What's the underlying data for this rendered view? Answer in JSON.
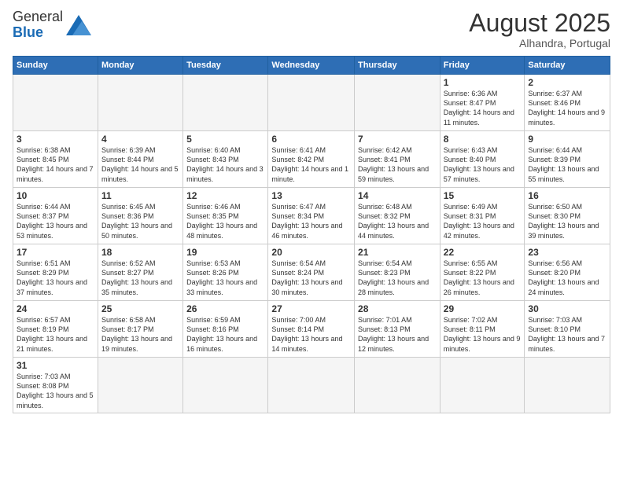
{
  "logo": {
    "general": "General",
    "blue": "Blue"
  },
  "title": {
    "month_year": "August 2025",
    "location": "Alhandra, Portugal"
  },
  "header_days": [
    "Sunday",
    "Monday",
    "Tuesday",
    "Wednesday",
    "Thursday",
    "Friday",
    "Saturday"
  ],
  "weeks": [
    [
      {
        "num": "",
        "info": ""
      },
      {
        "num": "",
        "info": ""
      },
      {
        "num": "",
        "info": ""
      },
      {
        "num": "",
        "info": ""
      },
      {
        "num": "",
        "info": ""
      },
      {
        "num": "1",
        "info": "Sunrise: 6:36 AM\nSunset: 8:47 PM\nDaylight: 14 hours and 11 minutes."
      },
      {
        "num": "2",
        "info": "Sunrise: 6:37 AM\nSunset: 8:46 PM\nDaylight: 14 hours and 9 minutes."
      }
    ],
    [
      {
        "num": "3",
        "info": "Sunrise: 6:38 AM\nSunset: 8:45 PM\nDaylight: 14 hours and 7 minutes."
      },
      {
        "num": "4",
        "info": "Sunrise: 6:39 AM\nSunset: 8:44 PM\nDaylight: 14 hours and 5 minutes."
      },
      {
        "num": "5",
        "info": "Sunrise: 6:40 AM\nSunset: 8:43 PM\nDaylight: 14 hours and 3 minutes."
      },
      {
        "num": "6",
        "info": "Sunrise: 6:41 AM\nSunset: 8:42 PM\nDaylight: 14 hours and 1 minute."
      },
      {
        "num": "7",
        "info": "Sunrise: 6:42 AM\nSunset: 8:41 PM\nDaylight: 13 hours and 59 minutes."
      },
      {
        "num": "8",
        "info": "Sunrise: 6:43 AM\nSunset: 8:40 PM\nDaylight: 13 hours and 57 minutes."
      },
      {
        "num": "9",
        "info": "Sunrise: 6:44 AM\nSunset: 8:39 PM\nDaylight: 13 hours and 55 minutes."
      }
    ],
    [
      {
        "num": "10",
        "info": "Sunrise: 6:44 AM\nSunset: 8:37 PM\nDaylight: 13 hours and 53 minutes."
      },
      {
        "num": "11",
        "info": "Sunrise: 6:45 AM\nSunset: 8:36 PM\nDaylight: 13 hours and 50 minutes."
      },
      {
        "num": "12",
        "info": "Sunrise: 6:46 AM\nSunset: 8:35 PM\nDaylight: 13 hours and 48 minutes."
      },
      {
        "num": "13",
        "info": "Sunrise: 6:47 AM\nSunset: 8:34 PM\nDaylight: 13 hours and 46 minutes."
      },
      {
        "num": "14",
        "info": "Sunrise: 6:48 AM\nSunset: 8:32 PM\nDaylight: 13 hours and 44 minutes."
      },
      {
        "num": "15",
        "info": "Sunrise: 6:49 AM\nSunset: 8:31 PM\nDaylight: 13 hours and 42 minutes."
      },
      {
        "num": "16",
        "info": "Sunrise: 6:50 AM\nSunset: 8:30 PM\nDaylight: 13 hours and 39 minutes."
      }
    ],
    [
      {
        "num": "17",
        "info": "Sunrise: 6:51 AM\nSunset: 8:29 PM\nDaylight: 13 hours and 37 minutes."
      },
      {
        "num": "18",
        "info": "Sunrise: 6:52 AM\nSunset: 8:27 PM\nDaylight: 13 hours and 35 minutes."
      },
      {
        "num": "19",
        "info": "Sunrise: 6:53 AM\nSunset: 8:26 PM\nDaylight: 13 hours and 33 minutes."
      },
      {
        "num": "20",
        "info": "Sunrise: 6:54 AM\nSunset: 8:24 PM\nDaylight: 13 hours and 30 minutes."
      },
      {
        "num": "21",
        "info": "Sunrise: 6:54 AM\nSunset: 8:23 PM\nDaylight: 13 hours and 28 minutes."
      },
      {
        "num": "22",
        "info": "Sunrise: 6:55 AM\nSunset: 8:22 PM\nDaylight: 13 hours and 26 minutes."
      },
      {
        "num": "23",
        "info": "Sunrise: 6:56 AM\nSunset: 8:20 PM\nDaylight: 13 hours and 24 minutes."
      }
    ],
    [
      {
        "num": "24",
        "info": "Sunrise: 6:57 AM\nSunset: 8:19 PM\nDaylight: 13 hours and 21 minutes."
      },
      {
        "num": "25",
        "info": "Sunrise: 6:58 AM\nSunset: 8:17 PM\nDaylight: 13 hours and 19 minutes."
      },
      {
        "num": "26",
        "info": "Sunrise: 6:59 AM\nSunset: 8:16 PM\nDaylight: 13 hours and 16 minutes."
      },
      {
        "num": "27",
        "info": "Sunrise: 7:00 AM\nSunset: 8:14 PM\nDaylight: 13 hours and 14 minutes."
      },
      {
        "num": "28",
        "info": "Sunrise: 7:01 AM\nSunset: 8:13 PM\nDaylight: 13 hours and 12 minutes."
      },
      {
        "num": "29",
        "info": "Sunrise: 7:02 AM\nSunset: 8:11 PM\nDaylight: 13 hours and 9 minutes."
      },
      {
        "num": "30",
        "info": "Sunrise: 7:03 AM\nSunset: 8:10 PM\nDaylight: 13 hours and 7 minutes."
      }
    ],
    [
      {
        "num": "31",
        "info": "Sunrise: 7:03 AM\nSunset: 8:08 PM\nDaylight: 13 hours and 5 minutes."
      },
      {
        "num": "",
        "info": ""
      },
      {
        "num": "",
        "info": ""
      },
      {
        "num": "",
        "info": ""
      },
      {
        "num": "",
        "info": ""
      },
      {
        "num": "",
        "info": ""
      },
      {
        "num": "",
        "info": ""
      }
    ]
  ]
}
